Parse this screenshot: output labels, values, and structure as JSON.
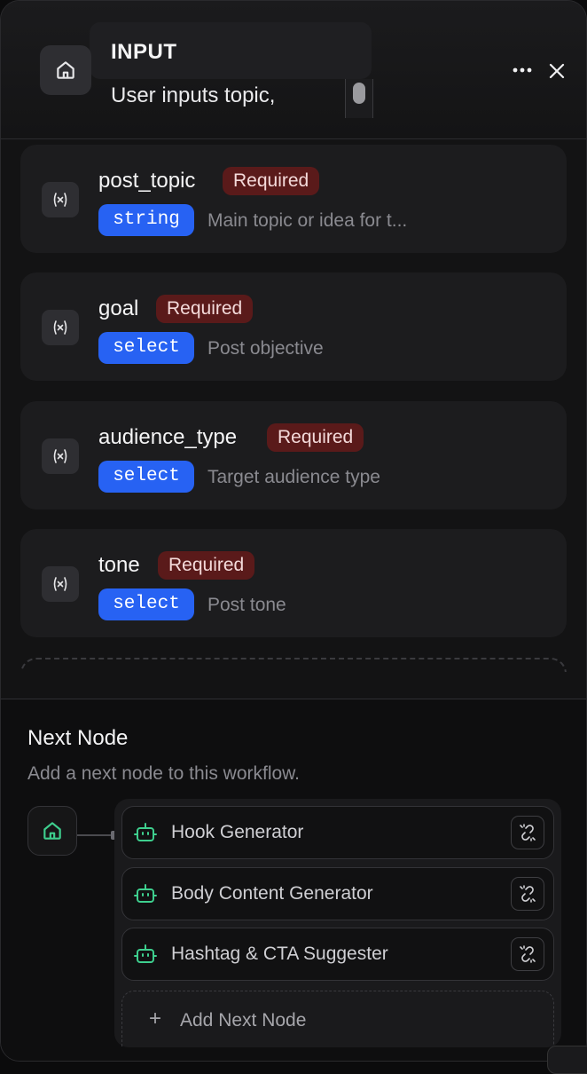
{
  "header": {
    "title": "INPUT",
    "description": "User inputs topic,"
  },
  "variables": [
    {
      "name": "post_topic",
      "required_label": "Required",
      "type": "string",
      "description": "Main topic or idea for t..."
    },
    {
      "name": "goal",
      "required_label": "Required",
      "type": "select",
      "description": "Post objective"
    },
    {
      "name": "audience_type",
      "required_label": "Required",
      "type": "select",
      "description": "Target audience type"
    },
    {
      "name": "tone",
      "required_label": "Required",
      "type": "select",
      "description": "Post tone"
    }
  ],
  "next_node": {
    "title": "Next Node",
    "subtitle": "Add a next node to this workflow.",
    "items": [
      {
        "label": "Hook Generator"
      },
      {
        "label": "Body Content Generator"
      },
      {
        "label": "Hashtag & CTA Suggester"
      }
    ],
    "add_label": "Add Next Node"
  },
  "colors": {
    "accent_blue": "#2762f3",
    "required_badge": "#5a1a1a",
    "robot_green": "#3ecf8e"
  },
  "icons": {
    "node": "home-icon",
    "variable": "variable-icon",
    "more": "more-horizontal-icon",
    "close": "close-icon",
    "llm": "robot-icon",
    "unlink": "unlink-icon",
    "add": "plus-icon"
  }
}
